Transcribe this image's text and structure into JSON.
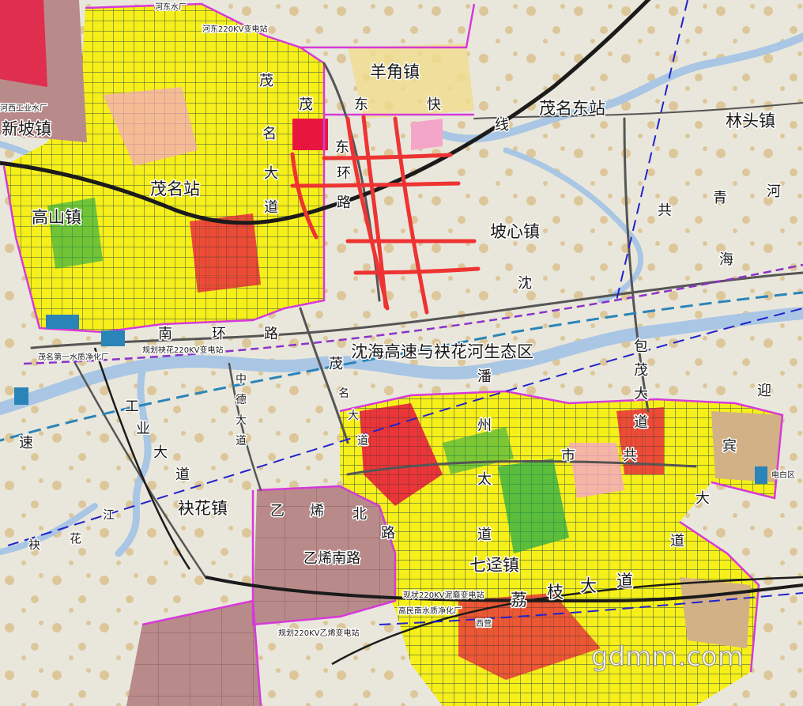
{
  "towns": {
    "xinpo": "新坡镇",
    "gaoshan": "高山镇",
    "yangjiao": "羊角镇",
    "linto": "林头镇",
    "poxin": "坡心镇",
    "fuhua": "袂花镇",
    "qijing": "七迳镇"
  },
  "stations": {
    "maoming": "茂名站",
    "maoming_east": "茂名东站"
  },
  "zone": "沈海高速与袂花河生态区",
  "roads": {
    "maoming_dadao": [
      "茂",
      "茂",
      "名",
      "大",
      "道"
    ],
    "dongxian": [
      "东",
      "快",
      "线"
    ],
    "donghuan": [
      "东",
      "环",
      "路"
    ],
    "nanhuan": [
      "南",
      "环",
      "路"
    ],
    "shenhai": [
      "共",
      "青",
      "河",
      "海",
      "沈"
    ],
    "baomao": [
      "包",
      "茂",
      "大",
      "道"
    ],
    "yingbin": [
      "迎",
      "宾",
      "大",
      "道"
    ],
    "zhongde": [
      "中",
      "德",
      "大",
      "道"
    ],
    "gongye": [
      "工",
      "业",
      "大",
      "道"
    ],
    "maoming_s": [
      "茂",
      "名",
      "大",
      "道"
    ],
    "pan": "潘",
    "zhouzhou": [
      "州",
      "太",
      "道"
    ],
    "shigong": [
      "市",
      "共"
    ],
    "yixi_bei": [
      "乙",
      "烯",
      "北",
      "路"
    ],
    "yixi_nan": "乙烯南路",
    "lizhi": [
      "荔",
      "枝",
      "大",
      "道"
    ],
    "su": "速",
    "fuhua_river": [
      "江",
      "花",
      "袂"
    ]
  },
  "small": {
    "hedong_water": "河东水厂",
    "hedong_sub": "河东220KV变电站",
    "hexi_water": "河西工业水厂",
    "plan_sub": "规划袂花220KV变电站",
    "purify1": "茂名第一水质净化厂",
    "niqi_sub": "现状220KV泥裔变电站",
    "purify2": "高民南水质净化厂",
    "yixi_sub": "规划220KV乙烯变电站",
    "dian_bai": "电白区",
    "xiang": "西营"
  },
  "watermark": "gdmm.com",
  "colors": {
    "land": "#e9e7dc",
    "water": "#a9c6e4",
    "residential": "#f7ef1a",
    "commercial": "#e8163f",
    "green": "#19a64a",
    "industrial": "#b98a8a",
    "boundary": "#d63ad8",
    "planned_road": "#ee3333",
    "railway": "#1b1b1b"
  }
}
